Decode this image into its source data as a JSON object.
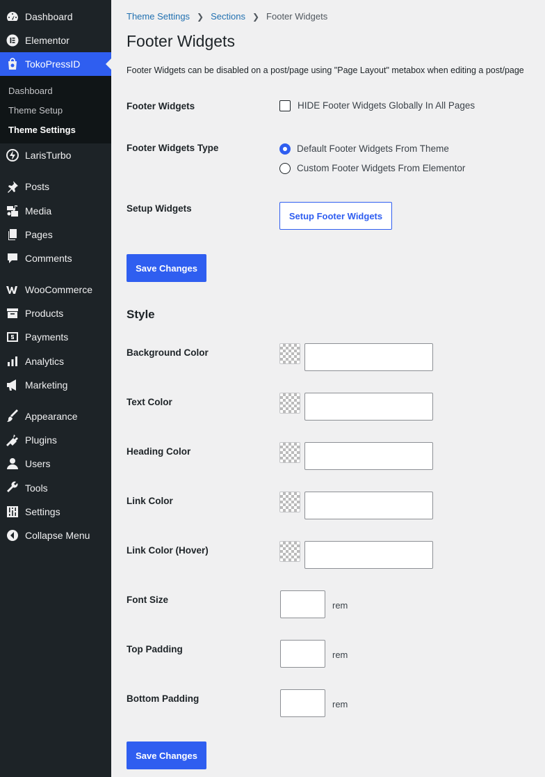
{
  "sidebar": {
    "items": [
      {
        "label": "Dashboard",
        "icon": "dashboard-icon"
      },
      {
        "label": "Elementor",
        "icon": "elementor-icon"
      },
      {
        "label": "TokoPressID",
        "icon": "tokopress-icon"
      },
      {
        "label": "LarisTurbo",
        "icon": "laristurbo-icon"
      },
      {
        "label": "Posts",
        "icon": "pin-icon"
      },
      {
        "label": "Media",
        "icon": "media-icon"
      },
      {
        "label": "Pages",
        "icon": "pages-icon"
      },
      {
        "label": "Comments",
        "icon": "comment-icon"
      },
      {
        "label": "WooCommerce",
        "icon": "woocommerce-icon"
      },
      {
        "label": "Products",
        "icon": "archive-icon"
      },
      {
        "label": "Payments",
        "icon": "money-icon"
      },
      {
        "label": "Analytics",
        "icon": "chart-bar-icon"
      },
      {
        "label": "Marketing",
        "icon": "megaphone-icon"
      },
      {
        "label": "Appearance",
        "icon": "brush-icon"
      },
      {
        "label": "Plugins",
        "icon": "plug-icon"
      },
      {
        "label": "Users",
        "icon": "user-icon"
      },
      {
        "label": "Tools",
        "icon": "wrench-icon"
      },
      {
        "label": "Settings",
        "icon": "settings-sliders-icon"
      },
      {
        "label": "Collapse Menu",
        "icon": "collapse-icon"
      }
    ],
    "submenu": [
      "Dashboard",
      "Theme Setup",
      "Theme Settings"
    ]
  },
  "breadcrumb": {
    "items": [
      "Theme Settings",
      "Sections"
    ],
    "current": "Footer Widgets"
  },
  "page": {
    "title": "Footer Widgets",
    "description": "Footer Widgets can be disabled on a post/page using \"Page Layout\" metabox when editing a post/page"
  },
  "settings": {
    "footer_widgets_label": "Footer Widgets",
    "hide_checkbox_label": "HIDE Footer Widgets Globally In All Pages",
    "hide_checked": false,
    "type_label": "Footer Widgets Type",
    "type_options": [
      "Default Footer Widgets From Theme",
      "Custom Footer Widgets From Elementor"
    ],
    "type_selected": "Default Footer Widgets From Theme",
    "setup_label": "Setup Widgets",
    "setup_button": "Setup Footer Widgets",
    "save_button": "Save Changes"
  },
  "style": {
    "heading": "Style",
    "colors": [
      {
        "label": "Background Color",
        "value": ""
      },
      {
        "label": "Text Color",
        "value": ""
      },
      {
        "label": "Heading Color",
        "value": ""
      },
      {
        "label": "Link Color",
        "value": ""
      },
      {
        "label": "Link Color (Hover)",
        "value": ""
      }
    ],
    "dimensions": [
      {
        "label": "Font Size",
        "value": "",
        "unit": "rem"
      },
      {
        "label": "Top Padding",
        "value": "",
        "unit": "rem"
      },
      {
        "label": "Bottom Padding",
        "value": "",
        "unit": "rem"
      }
    ],
    "save_button": "Save Changes"
  },
  "colors": {
    "sidebar_bg": "#1d2327",
    "submenu_bg": "#101517",
    "accent": "#2f5ef0",
    "page_bg": "#f0f0f1",
    "link": "#2271b1"
  }
}
